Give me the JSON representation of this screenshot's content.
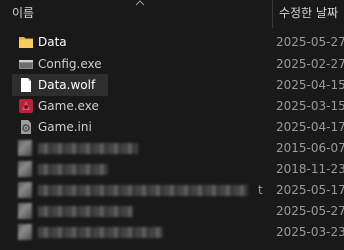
{
  "header": {
    "name_label": "이름",
    "date_label": "수정한 날짜"
  },
  "files": [
    {
      "name": "Data",
      "date": "2025-05-27",
      "type": "folder"
    },
    {
      "name": "Config.exe",
      "date": "2025-02-27",
      "type": "config-exe"
    },
    {
      "name": "Data.wolf",
      "date": "2025-04-15",
      "type": "document"
    },
    {
      "name": "Game.exe",
      "date": "2025-03-15",
      "type": "game-exe"
    },
    {
      "name": "Game.ini",
      "date": "2025-04-17",
      "type": "ini"
    }
  ],
  "redacted": [
    {
      "date": "2015-06-07",
      "tail": ""
    },
    {
      "date": "2018-11-23",
      "tail": ""
    },
    {
      "date": "2025-05-17",
      "tail": "t"
    },
    {
      "date": "2025-05-27",
      "tail": ""
    },
    {
      "date": "2025-03-23",
      "tail": ""
    }
  ],
  "colors": {
    "background": "#191919",
    "folder_icon": "#f2c14e",
    "selection": "#2e2e2e",
    "date_text": "#9a9a9a"
  }
}
